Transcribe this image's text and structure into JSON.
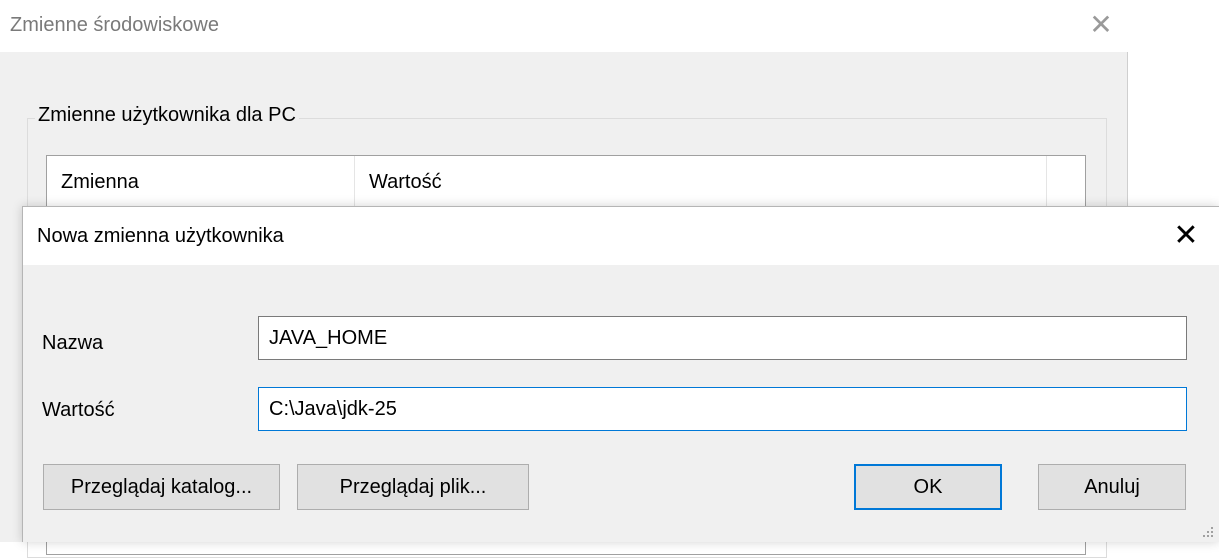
{
  "background_window": {
    "title": "Zmienne środowiskowe",
    "close_glyph": "✕",
    "group_label": "Zmienne użytkownika dla PC",
    "columns": [
      "Zmienna",
      "Wartość"
    ]
  },
  "dialog": {
    "title": "Nowa zmienna użytkownika",
    "close_glyph": "✕",
    "name_label": "Nazwa",
    "name_value": "JAVA_HOME",
    "value_label": "Wartość",
    "value_value": "C:\\Java\\jdk-25",
    "buttons": {
      "browse_directory": "Przeglądaj katalog...",
      "browse_file": "Przeglądaj plik...",
      "ok": "OK",
      "cancel": "Anuluj"
    }
  },
  "colors": {
    "accent": "#0078d7",
    "window_bg": "#f0f0f0",
    "button_bg": "#e1e1e1"
  },
  "icons": {
    "close": "close-icon",
    "resize_grip": "resize-grip-icon"
  }
}
